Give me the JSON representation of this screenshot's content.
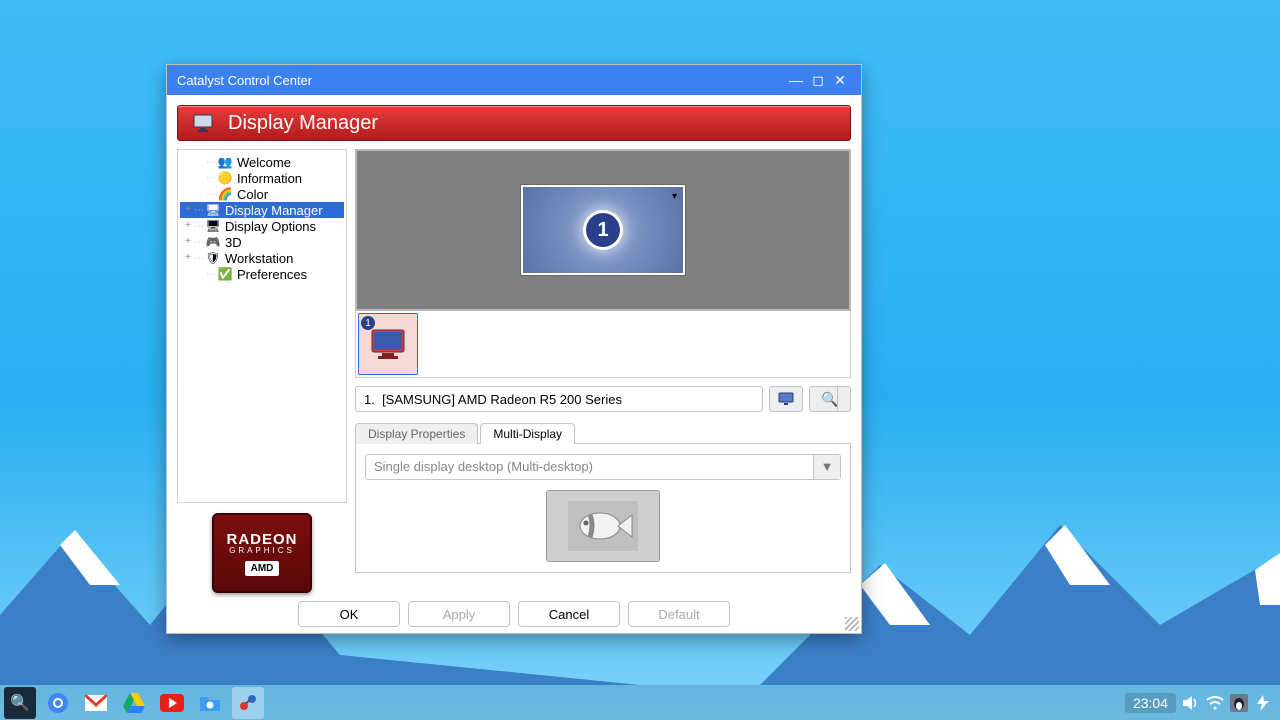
{
  "window": {
    "title": "Catalyst Control Center",
    "header": "Display Manager"
  },
  "tree": {
    "items": [
      {
        "label": "Welcome",
        "expander": "",
        "indent": 1,
        "selected": false
      },
      {
        "label": "Information",
        "expander": "",
        "indent": 1,
        "selected": false
      },
      {
        "label": "Color",
        "expander": "",
        "indent": 1,
        "selected": false
      },
      {
        "label": "Display Manager",
        "expander": "+",
        "indent": 0,
        "selected": true
      },
      {
        "label": "Display Options",
        "expander": "+",
        "indent": 0,
        "selected": false
      },
      {
        "label": "3D",
        "expander": "+",
        "indent": 0,
        "selected": false
      },
      {
        "label": "Workstation",
        "expander": "+",
        "indent": 0,
        "selected": false
      },
      {
        "label": "Preferences",
        "expander": "",
        "indent": 1,
        "selected": false
      }
    ]
  },
  "display": {
    "monitor_number": "1",
    "thumb_number": "1",
    "device": "1.  [SAMSUNG] AMD Radeon R5 200 Series"
  },
  "tabs": {
    "items": [
      "Display Properties",
      "Multi-Display"
    ],
    "active": 1,
    "multi_display_mode": "Single display desktop (Multi-desktop)"
  },
  "buttons": {
    "ok": "OK",
    "apply": "Apply",
    "cancel": "Cancel",
    "default": "Default"
  },
  "logo": {
    "line1": "RADEON",
    "line2": "GRAPHICS",
    "line3": "AMD"
  },
  "taskbar": {
    "clock": "23:04"
  }
}
